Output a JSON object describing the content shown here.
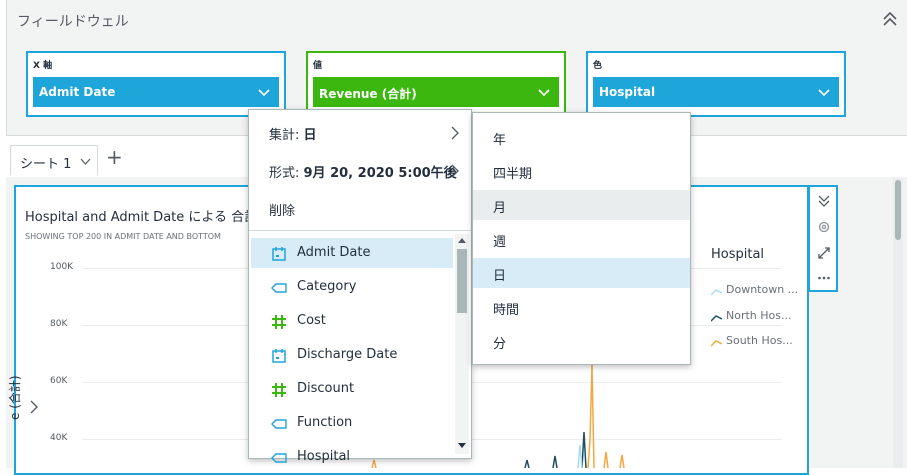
{
  "field_wells": {
    "title": "フィールドウェル",
    "wells": [
      {
        "label": "X 軸",
        "field": "Admit Date"
      },
      {
        "label": "値",
        "field": "Revenue (合計)"
      },
      {
        "label": "色",
        "field": "Hospital"
      }
    ]
  },
  "tabs": {
    "sheet_label": "シート 1",
    "add_label": "+"
  },
  "visual": {
    "title": "Hospital and Admit Date による 合計",
    "subtitle": "SHOWING TOP 200 IN ADMIT DATE AND BOTTOM",
    "y_label": "e (合計)",
    "legend_title": "Hospital",
    "legend": [
      {
        "name": "Downtown ...",
        "color": "#a6dcf4"
      },
      {
        "name": "North Hos...",
        "color": "#1f4e5f"
      },
      {
        "name": "South Hos...",
        "color": "#f5a742"
      }
    ]
  },
  "chart_data": {
    "type": "line",
    "title": "Hospital and Admit Date による 合計",
    "subtitle": "SHOWING TOP 200 IN ADMIT DATE AND BOTTOM",
    "ylabel": "e (合計)",
    "y_ticks": [
      "100K",
      "80K",
      "60K",
      "40K"
    ],
    "ylim": [
      20000,
      100000
    ],
    "legend_title": "Hospital",
    "series": [
      {
        "name": "Downtown ...",
        "color": "#a6dcf4"
      },
      {
        "name": "North Hos...",
        "color": "#1f4e5f"
      },
      {
        "name": "South Hos...",
        "color": "#f5a742"
      }
    ]
  },
  "menu": {
    "aggregate_prefix": "集計: ",
    "aggregate_value": "日",
    "format_prefix": "形式: ",
    "format_value": "9月 20, 2020 5:00午後",
    "delete_label": "削除",
    "fields": [
      {
        "name": "Admit Date",
        "icon": "calendar-icon",
        "active": true
      },
      {
        "name": "Category",
        "icon": "tag-icon",
        "active": false
      },
      {
        "name": "Cost",
        "icon": "hash-icon",
        "active": false
      },
      {
        "name": "Discharge Date",
        "icon": "calendar-icon",
        "active": false
      },
      {
        "name": "Discount",
        "icon": "hash-icon",
        "active": false
      },
      {
        "name": "Function",
        "icon": "tag-icon",
        "active": false
      },
      {
        "name": "Hospital",
        "icon": "tag-icon",
        "active": false
      }
    ]
  },
  "submenu": {
    "items": [
      "年",
      "四半期",
      "月",
      "週",
      "日",
      "時間",
      "分"
    ],
    "hover": "月",
    "selected": "日"
  },
  "colors": {
    "accent_blue": "#1ea5d9",
    "accent_green": "#3bb70f",
    "selected_bg": "#d7ecf6"
  }
}
